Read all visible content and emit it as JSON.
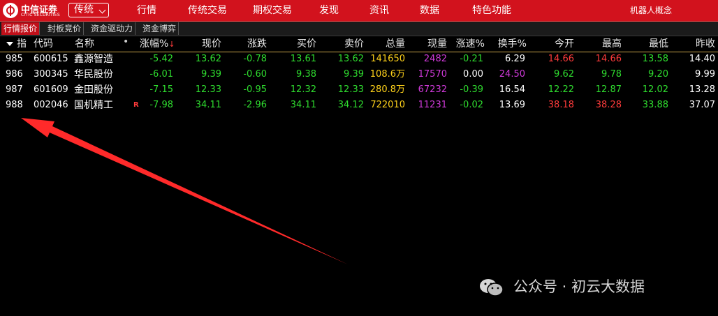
{
  "app": {
    "logo_cn": "中信证券",
    "logo_en": "CITIC SECURITIES",
    "mode": "传统"
  },
  "menu": [
    "行情",
    "传统交易",
    "期权交易",
    "发现",
    "资讯",
    "数据",
    "特色功能",
    "机器人概念"
  ],
  "subtabs": [
    "行情报价",
    "封板竞价",
    "资金驱动力",
    "资金博弈"
  ],
  "table": {
    "headers": {
      "idx": "指",
      "code": "代码",
      "name": "名称",
      "pct": "涨幅%",
      "price": "现价",
      "change": "涨跌",
      "bid": "买价",
      "ask": "卖价",
      "volume": "总量",
      "cur_vol": "现量",
      "speed": "涨速%",
      "turnover": "换手%",
      "open": "今开",
      "high": "最高",
      "low": "最低",
      "prev": "昨收"
    },
    "rows": [
      {
        "idx": "985",
        "code": "600615",
        "name": "鑫源智造",
        "flag": "",
        "pct": "-5.42",
        "price": "13.62",
        "change": "-0.78",
        "bid": "13.61",
        "ask": "13.62",
        "volume": "141650",
        "cur_vol": "2482",
        "speed": "-0.21",
        "turnover": "6.29",
        "open": "14.66",
        "high": "14.66",
        "low": "13.58",
        "prev": "14.40"
      },
      {
        "idx": "986",
        "code": "300345",
        "name": "华民股份",
        "flag": "",
        "pct": "-6.01",
        "price": "9.39",
        "change": "-0.60",
        "bid": "9.38",
        "ask": "9.39",
        "volume": "108.6万",
        "cur_vol": "17570",
        "speed": "0.00",
        "turnover": "24.50",
        "open": "9.62",
        "high": "9.78",
        "low": "9.20",
        "prev": "9.99"
      },
      {
        "idx": "987",
        "code": "601609",
        "name": "金田股份",
        "flag": "",
        "pct": "-7.15",
        "price": "12.33",
        "change": "-0.95",
        "bid": "12.32",
        "ask": "12.33",
        "volume": "280.8万",
        "cur_vol": "67232",
        "speed": "-0.39",
        "turnover": "16.54",
        "open": "12.22",
        "high": "12.87",
        "low": "12.02",
        "prev": "13.28"
      },
      {
        "idx": "988",
        "code": "002046",
        "name": "国机精工",
        "flag": "R",
        "pct": "-7.98",
        "price": "34.11",
        "change": "-2.96",
        "bid": "34.11",
        "ask": "34.12",
        "volume": "722010",
        "cur_vol": "11231",
        "speed": "-0.02",
        "turnover": "13.69",
        "open": "38.18",
        "high": "38.28",
        "low": "33.88",
        "prev": "37.07"
      }
    ]
  },
  "watermark": "公众号 · 初云大数据",
  "colors": {
    "brand_red": "#d2121d",
    "rise": "#ff3b3b",
    "fall": "#2fdd2f",
    "volume": "#ffd21a",
    "magenta": "#d13adb",
    "annotation_arrow": "#ff2a2a"
  }
}
